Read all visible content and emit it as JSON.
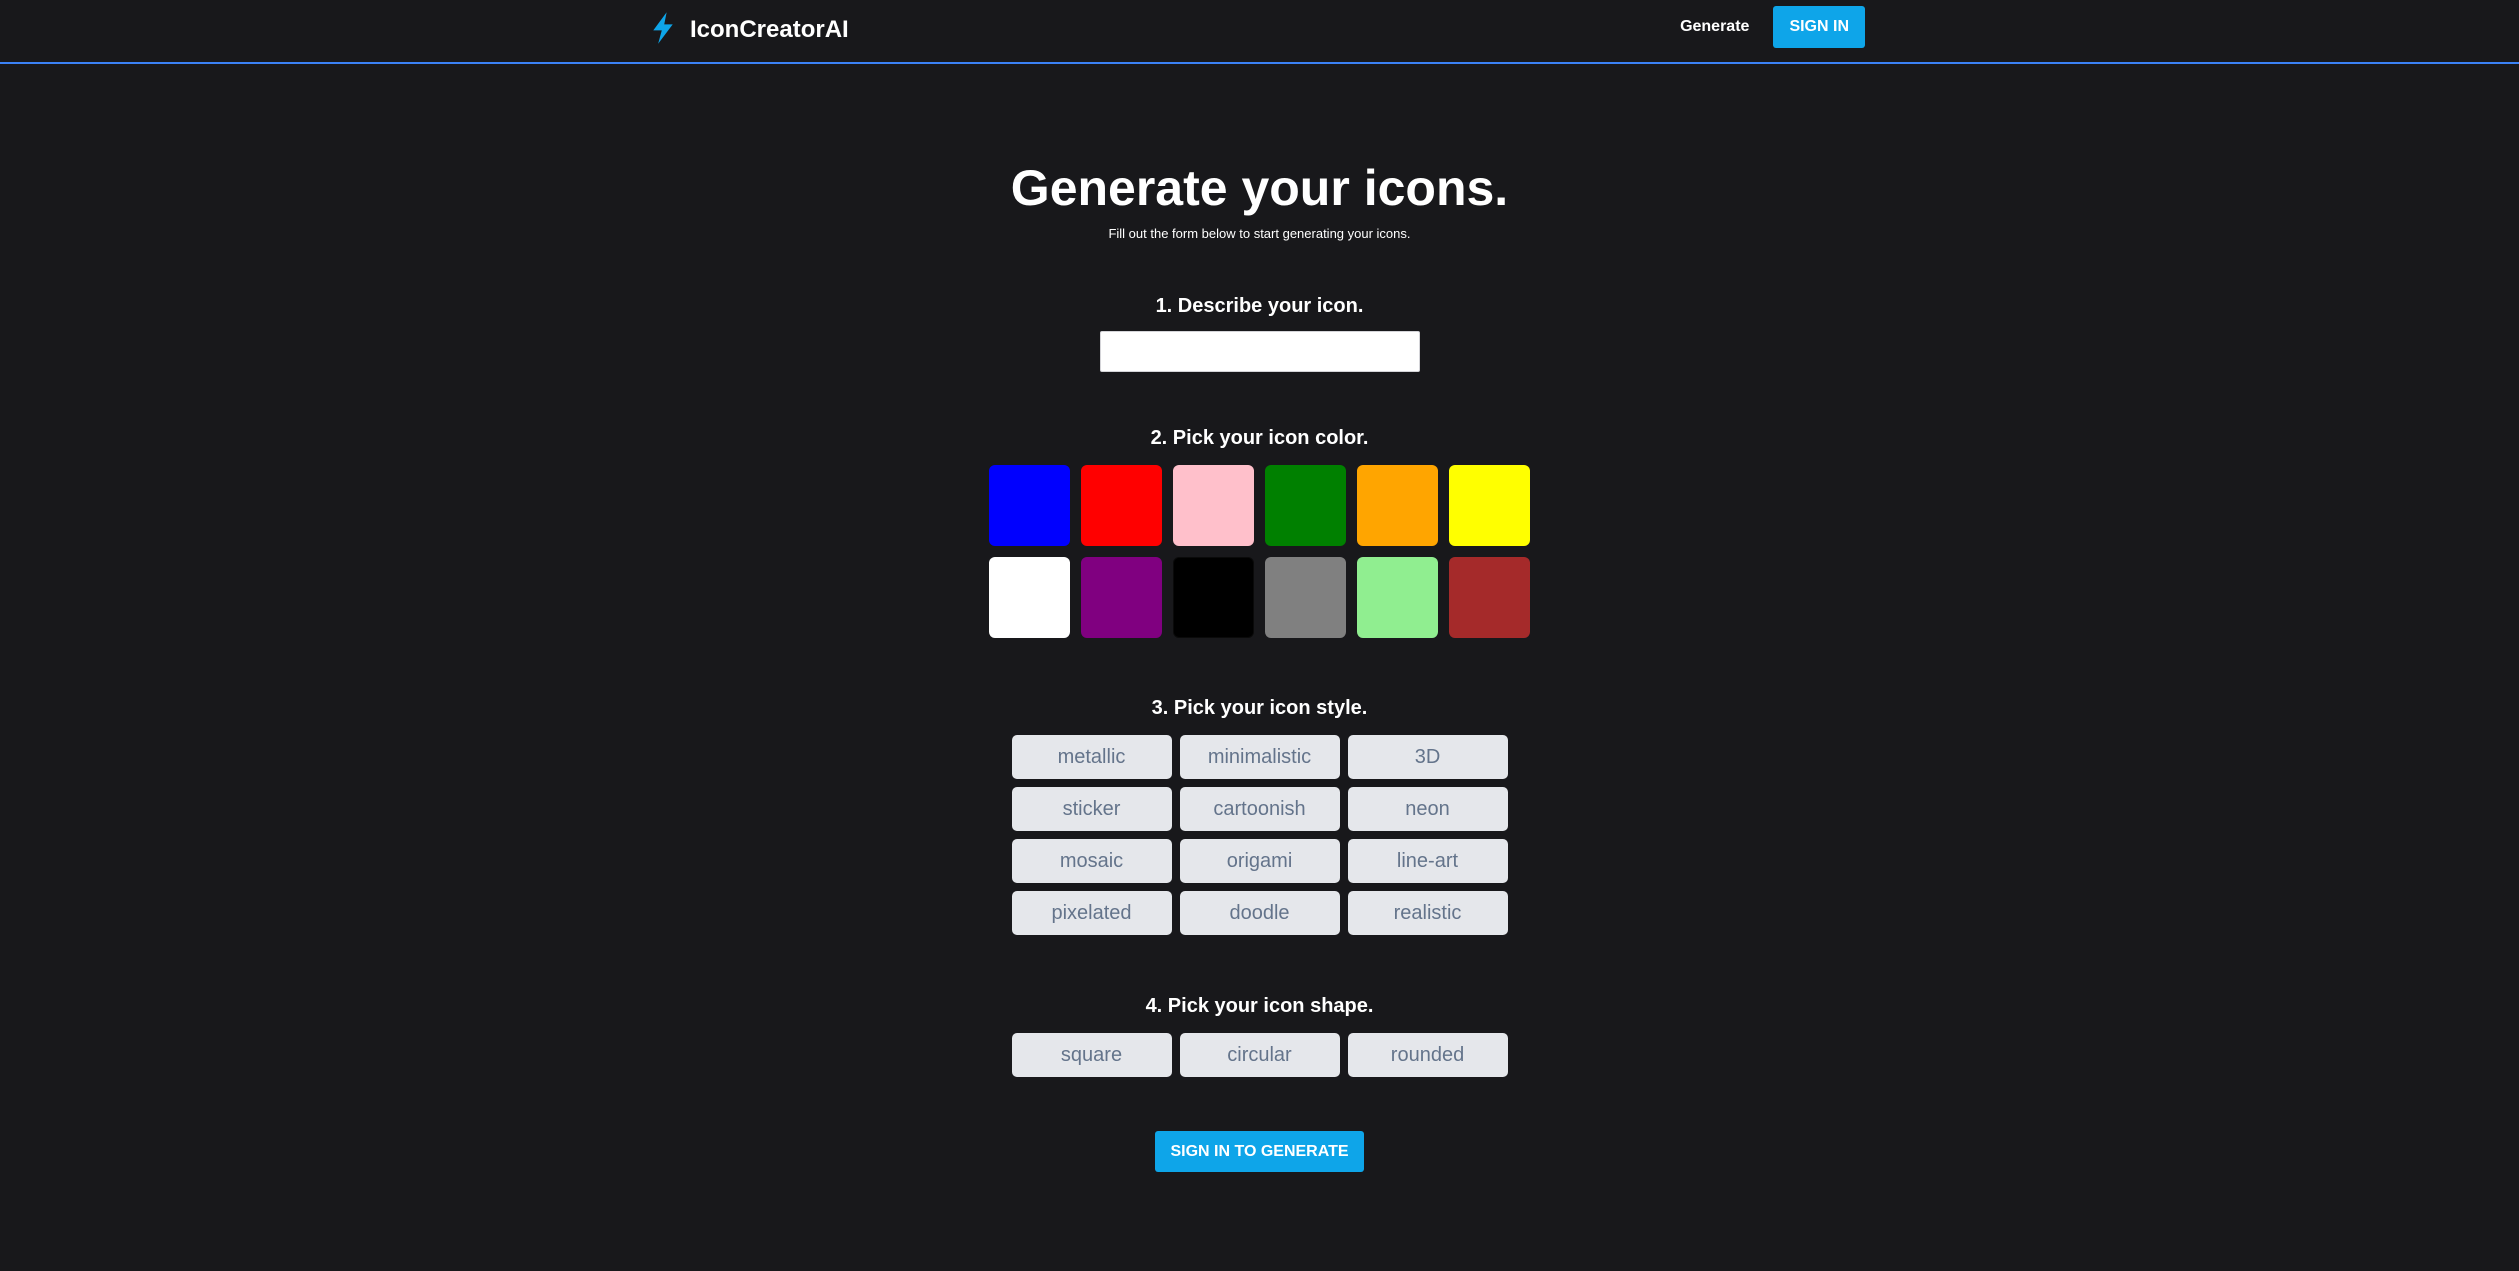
{
  "header": {
    "brand_name": "IconCreatorAI",
    "brand_icon": "lightning-bolt-icon",
    "nav_generate_label": "Generate",
    "signin_label": "SIGN IN",
    "accent_color": "#0ea5e9"
  },
  "hero": {
    "title": "Generate your icons.",
    "subtitle": "Fill out the form below to start generating your icons."
  },
  "step1": {
    "label": "1. Describe your icon.",
    "value": ""
  },
  "step2": {
    "label": "2. Pick your icon color.",
    "colors": [
      "#0000ff",
      "#ff0000",
      "#ffc0cb",
      "#008000",
      "#ffa500",
      "#ffff00",
      "#ffffff",
      "#800080",
      "#000000",
      "#808080",
      "#90ee90",
      "#a52a2a"
    ]
  },
  "step3": {
    "label": "3. Pick your icon style.",
    "styles": [
      "metallic",
      "minimalistic",
      "3D",
      "sticker",
      "cartoonish",
      "neon",
      "mosaic",
      "origami",
      "line-art",
      "pixelated",
      "doodle",
      "realistic"
    ]
  },
  "step4": {
    "label": "4. Pick your icon shape.",
    "shapes": [
      "square",
      "circular",
      "rounded"
    ]
  },
  "submit_label": "SIGN IN TO GENERATE"
}
